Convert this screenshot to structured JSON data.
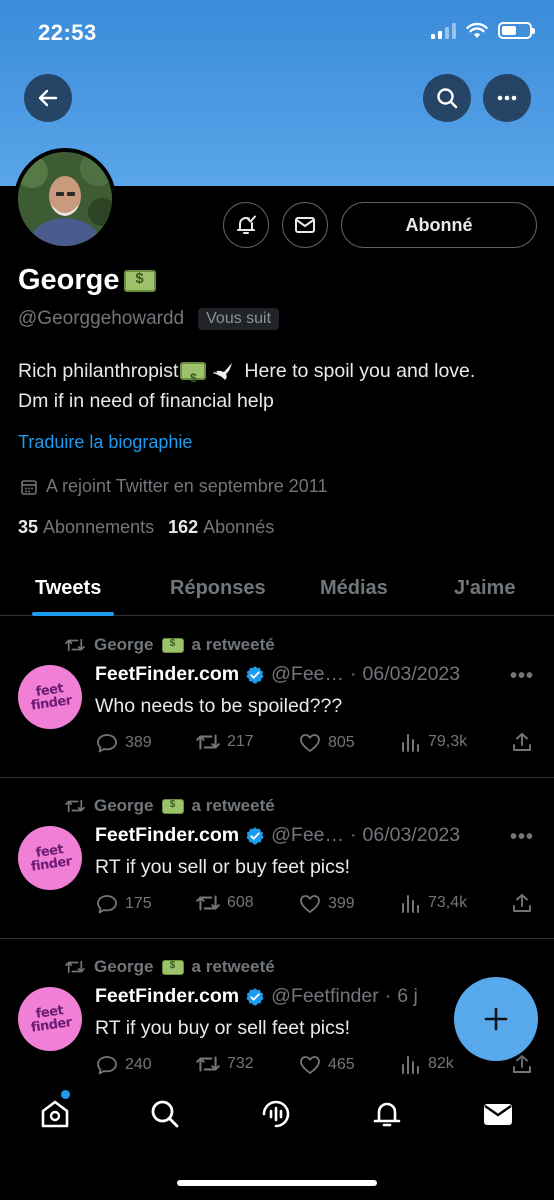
{
  "status_bar": {
    "time": "22:53"
  },
  "profile": {
    "name": "George",
    "handle": "@Georggehowardd",
    "follows_you": "Vous suit",
    "follow_button": "Abonné",
    "bio_line1_a": "Rich philanthropist",
    "bio_line1_b": "Here to spoil you and love.",
    "bio_line2": "Dm if in need of financial help",
    "translate_bio": "Traduire la biographie",
    "joined": "A rejoint Twitter en septembre 2011",
    "following_count": "35",
    "following_label": "Abonnements",
    "followers_count": "162",
    "followers_label": "Abonnés"
  },
  "tabs": [
    {
      "label": "Tweets",
      "active": true
    },
    {
      "label": "Réponses"
    },
    {
      "label": "Médias"
    },
    {
      "label": "J'aime"
    }
  ],
  "tweets": [
    {
      "retweeted_by": "George",
      "retweet_label": "a retweeté",
      "author": "FeetFinder.com",
      "handle": "@Fee…",
      "separator": "·",
      "date": "06/03/2023",
      "text": "Who needs to be spoiled???",
      "replies": "389",
      "retweets": "217",
      "likes": "805",
      "views": "79,3k",
      "avatar_logo": [
        "feet",
        "finder"
      ]
    },
    {
      "retweeted_by": "George",
      "retweet_label": "a retweeté",
      "author": "FeetFinder.com",
      "handle": "@Fee…",
      "separator": "·",
      "date": "06/03/2023",
      "text": "RT if you sell or buy feet pics!",
      "replies": "175",
      "retweets": "608",
      "likes": "399",
      "views": "73,4k",
      "avatar_logo": [
        "feet",
        "finder"
      ]
    },
    {
      "retweeted_by": "George",
      "retweet_label": "a retweeté",
      "author": "FeetFinder.com",
      "handle": "@Feetfinder",
      "separator": "·",
      "date": "6 j",
      "text": "RT if you buy or sell feet pics!",
      "replies": "240",
      "retweets": "732",
      "likes": "465",
      "views": "82k",
      "avatar_logo": [
        "feet",
        "finder"
      ]
    }
  ],
  "colors": {
    "accent": "#1d9bf0",
    "banner": "#4a9be5",
    "fab": "#58a9ec",
    "logo_bg": "#f07fd5"
  },
  "icons": [
    "back-arrow-icon",
    "search-icon",
    "more-icon",
    "bell-check-icon",
    "mail-icon",
    "calendar-icon",
    "retweet-icon",
    "verified-icon",
    "reply-icon",
    "like-icon",
    "views-icon",
    "share-icon",
    "plus-icon",
    "home-icon",
    "spaces-icon",
    "notifications-icon",
    "messages-icon"
  ]
}
